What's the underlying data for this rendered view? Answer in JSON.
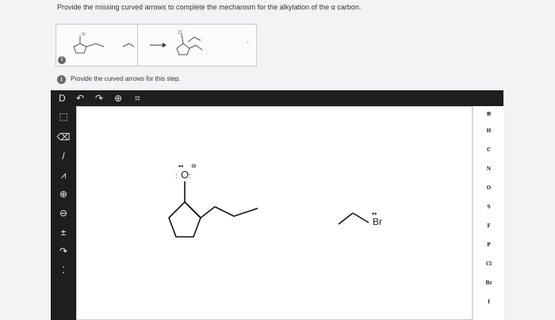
{
  "question": {
    "text": "Provide the missing curved arrows to complete the mechanism for the alkylation of the α carbon."
  },
  "thumbnail": {
    "info_badge": "i"
  },
  "step": {
    "info_badge": "i",
    "label": "Provide the curved arrows for this step."
  },
  "top_toolbar": {
    "items": [
      {
        "name": "file-icon",
        "glyph": "D"
      },
      {
        "name": "undo-icon",
        "glyph": "↶"
      },
      {
        "name": "redo-icon",
        "glyph": "↷"
      },
      {
        "name": "zoom-icon",
        "glyph": "⊕"
      },
      {
        "name": "template-icon",
        "glyph": "⌗"
      }
    ]
  },
  "left_toolbar": {
    "items": [
      {
        "name": "select-tool-icon",
        "glyph": "⬚"
      },
      {
        "name": "eraser-icon",
        "glyph": "⌫"
      },
      {
        "name": "bond-tool-icon",
        "glyph": "/"
      },
      {
        "name": "chain-tool-icon",
        "glyph": "⩘"
      },
      {
        "name": "positive-charge-icon",
        "glyph": "⊕"
      },
      {
        "name": "negative-charge-icon",
        "glyph": "⊖"
      },
      {
        "name": "stereo-icon",
        "glyph": "±"
      },
      {
        "name": "curved-arrow-icon",
        "glyph": "↷"
      },
      {
        "name": "lone-pair-icon",
        "glyph": "⁚"
      }
    ]
  },
  "right_toolbar": {
    "elements": [
      "H",
      "C",
      "N",
      "O",
      "S",
      "F",
      "P",
      "Cl",
      "Br",
      "I"
    ]
  },
  "canvas": {
    "oxygen_label": "O",
    "oxygen_charge": "⊖",
    "bromine_label": "Br"
  }
}
